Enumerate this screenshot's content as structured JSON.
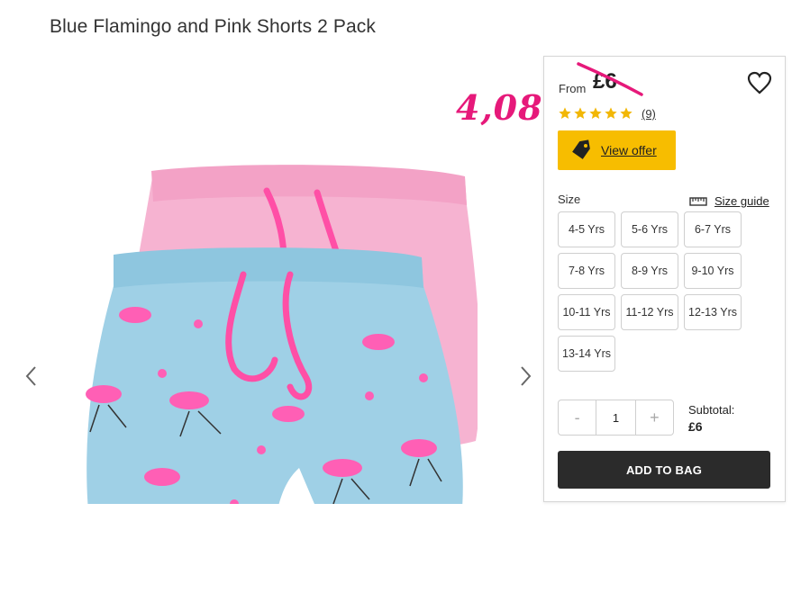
{
  "product": {
    "title": "Blue Flamingo and Pink Shorts 2 Pack",
    "image_alt": "Blue flamingo print shorts and pink shorts"
  },
  "pricing": {
    "from_label": "From",
    "price": "£6",
    "promo_annotation": "4,08",
    "annotation_color": "#e6197a"
  },
  "rating": {
    "stars": 5,
    "count_label": "(9)",
    "star_color": "#f2b705"
  },
  "offer": {
    "label": "View offer",
    "icon": "price-tag-icon",
    "bg_color": "#f7bd00"
  },
  "size": {
    "label": "Size",
    "guide_label": "Size guide",
    "guide_icon": "ruler-icon",
    "options": [
      "4-5 Yrs",
      "5-6 Yrs",
      "6-7 Yrs",
      "7-8 Yrs",
      "8-9 Yrs",
      "9-10 Yrs",
      "10-11 Yrs",
      "11-12 Yrs",
      "12-13 Yrs",
      "13-14 Yrs"
    ]
  },
  "quantity": {
    "minus": "-",
    "value": "1",
    "plus": "+"
  },
  "subtotal": {
    "label": "Subtotal:",
    "value": "£6"
  },
  "cart": {
    "add_label": "ADD TO BAG",
    "button_color": "#2b2b2b"
  },
  "gallery": {
    "prev_icon": "chevron-left-icon",
    "next_icon": "chevron-right-icon"
  },
  "wishlist": {
    "icon": "heart-icon"
  }
}
